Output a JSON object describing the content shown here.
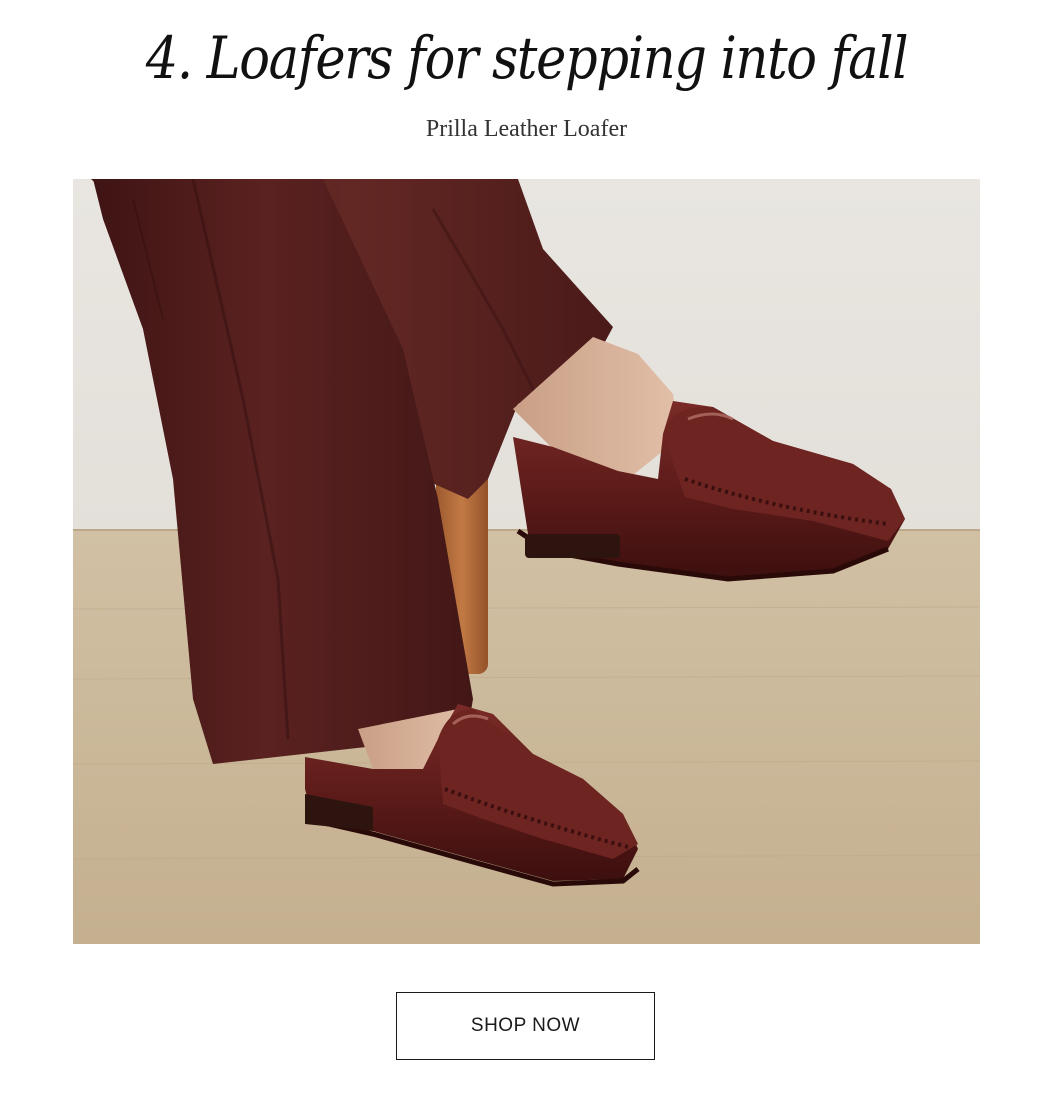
{
  "header": {
    "title": "4. Loafers for stepping into fall",
    "subtitle": "Prilla Leather Loafer"
  },
  "hero_image": {
    "alt": "Prilla Leather Loafer"
  },
  "cta": {
    "label": "SHOP NOW"
  },
  "colors": {
    "text": "#111111",
    "loafer": "#5a1a18",
    "trousers": "#4e1c1c",
    "wall": "#e8e5e0",
    "floor": "#cbb99c"
  }
}
